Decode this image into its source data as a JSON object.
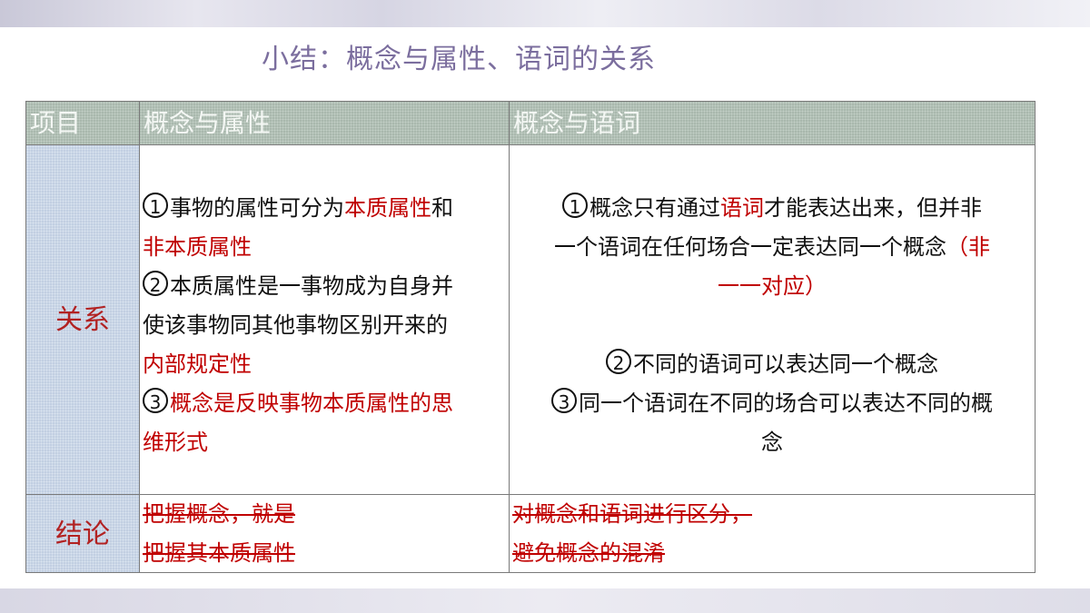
{
  "title": "小结：概念与属性、语词的关系",
  "table": {
    "headers": [
      "项目",
      "概念与属性",
      "概念与语词"
    ],
    "row_labels": [
      "关系",
      "结论"
    ],
    "relation_attr": {
      "p1_num": "1",
      "p1_a": "事物的属性可分为",
      "p1_b": "本质属性",
      "p1_c": "和",
      "p1_d": "非本质属性",
      "p2_num": "2",
      "p2_a": "本质属性是一事物成为自身并",
      "p2_b": "使该事物同其他事物区别开来的",
      "p2_c": "内部规定性",
      "p3_num": "3",
      "p3_a": "概念是反映事物本质属性的思",
      "p3_b": "维形式"
    },
    "relation_word": {
      "p1_num": "1",
      "p1_a": "概念只有通过",
      "p1_b": "语词",
      "p1_c": "才能表达出来，但并非",
      "p1_d": "一个语词在任何场合一定表达同一个概念",
      "p1_e": "（非",
      "p1_f": "一一对应）",
      "p2_num": "2",
      "p2_a": "不同的语词可以表达同一个概念",
      "p3_num": "3",
      "p3_a": "同一个语词在不同的场合可以表达不同的概",
      "p3_b": "念"
    },
    "conclusion_attr": [
      "把握概念，就是",
      "把握其本质属性"
    ],
    "conclusion_word": [
      "对概念和语词进行区分，",
      "避免概念的混淆"
    ]
  },
  "colors": {
    "title": "#7b6e9e",
    "header_bg": "#a9b8ad",
    "side_bg": "#c2cfe2",
    "accent_red": "#c00000"
  }
}
